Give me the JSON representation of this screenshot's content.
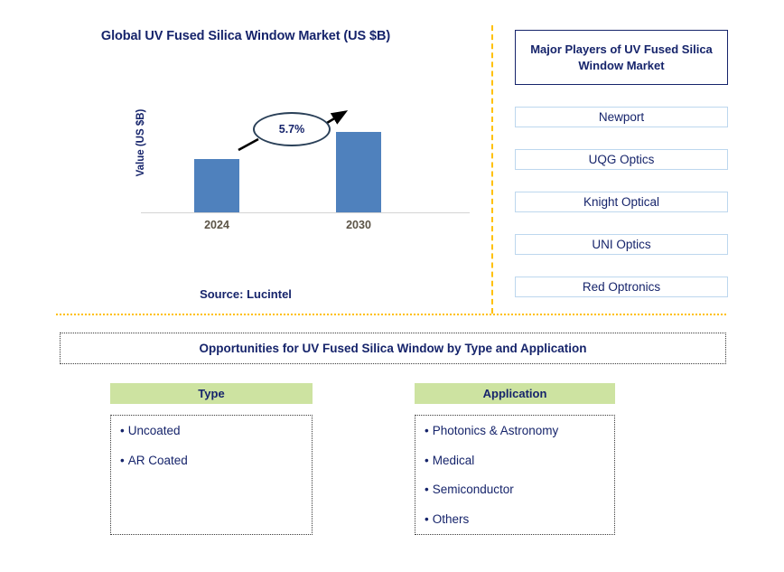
{
  "chart_data": {
    "type": "bar",
    "title": "Global UV Fused Silica Window Market (US $B)",
    "xlabel": "",
    "ylabel": "Value (US $B)",
    "categories": [
      "2024",
      "2030"
    ],
    "values": [
      59,
      89
    ],
    "bar_color": "#4F81BD",
    "grid": false,
    "legend": "none",
    "annotations": [
      {
        "label": "5.7%",
        "type": "cagr-callout",
        "from": "2024",
        "to": "2030"
      }
    ]
  },
  "chart": {
    "title": "Global UV Fused Silica Window Market (US $B)",
    "y_axis_label": "Value (US $B)",
    "cagr_label": "5.7%",
    "ticks": [
      "2024",
      "2030"
    ],
    "source": "Source: Lucintel"
  },
  "players": {
    "header": "Major Players of UV Fused Silica Window Market",
    "items": [
      "Newport",
      "UQG Optics",
      "Knight Optical",
      "UNI Optics",
      "Red Optronics"
    ]
  },
  "opportunities": {
    "banner": "Opportunities for UV Fused Silica Window by Type and Application",
    "type": {
      "header": "Type",
      "items": [
        "Uncoated",
        "AR Coated"
      ]
    },
    "application": {
      "header": "Application",
      "items": [
        "Photonics & Astronomy",
        "Medical",
        "Semiconductor",
        "Others"
      ]
    }
  },
  "colors": {
    "navy": "#16246B",
    "bar_blue": "#4F81BD",
    "gold_divider": "#FFC000",
    "green_header": "#CDE3A1"
  },
  "bullet_marker": "•"
}
